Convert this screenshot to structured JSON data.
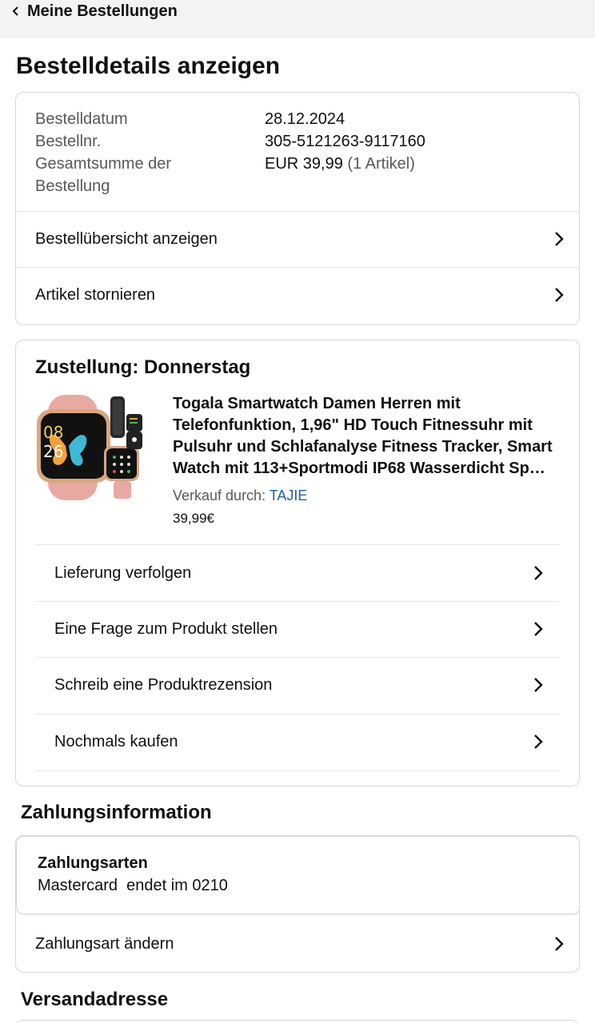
{
  "header": {
    "back_label": "Meine Bestellungen"
  },
  "page_title": "Bestelldetails anzeigen",
  "order_summary": {
    "date_label": "Bestelldatum",
    "date_value": "28.12.2024",
    "number_label": "Bestellnr.",
    "number_value": "305-5121263-9117160",
    "total_label_line1": "Gesamtsumme der",
    "total_label_line2": "Bestellung",
    "total_value": "EUR 39,99",
    "total_items": "(1 Artikel)"
  },
  "order_actions": [
    {
      "label": "Bestellübersicht anzeigen"
    },
    {
      "label": "Artikel stornieren"
    }
  ],
  "delivery": {
    "title": "Zustellung: Donnerstag",
    "product_title": "Togala Smartwatch Damen Herren mit Telefonfunktion, 1,96\" HD Touch Fitnessuhr mit Pulsuhr und Schlafanalyse Fitness Tracker, Smart Watch mit 113+Sportmodi IP68 Wasserdicht Sp…",
    "seller_label": "Verkauf durch:",
    "seller_name": "TAJIE",
    "price": "39,99€",
    "product_image_text_time": "08",
    "product_image_text_time2": "26",
    "actions": [
      {
        "label": "Lieferung verfolgen"
      },
      {
        "label": "Eine Frage zum Produkt stellen"
      },
      {
        "label": "Schreib eine Produktrezension"
      },
      {
        "label": "Nochmals kaufen"
      }
    ]
  },
  "payment": {
    "section_title": "Zahlungsinformation",
    "methods_heading": "Zahlungsarten",
    "card_text": "Mastercard  endet im 0210",
    "change_label": "Zahlungsart ändern"
  },
  "shipping": {
    "section_title": "Versandadresse"
  },
  "colors": {
    "text": "#0f1111",
    "muted": "#565959",
    "link": "#2162a1",
    "border": "#d5d9d9",
    "topbar": "#f3f3f3",
    "watch_band": "#e8a9a2"
  },
  "icons": {
    "back": "chevron-left-icon",
    "row": "chevron-right-icon"
  }
}
